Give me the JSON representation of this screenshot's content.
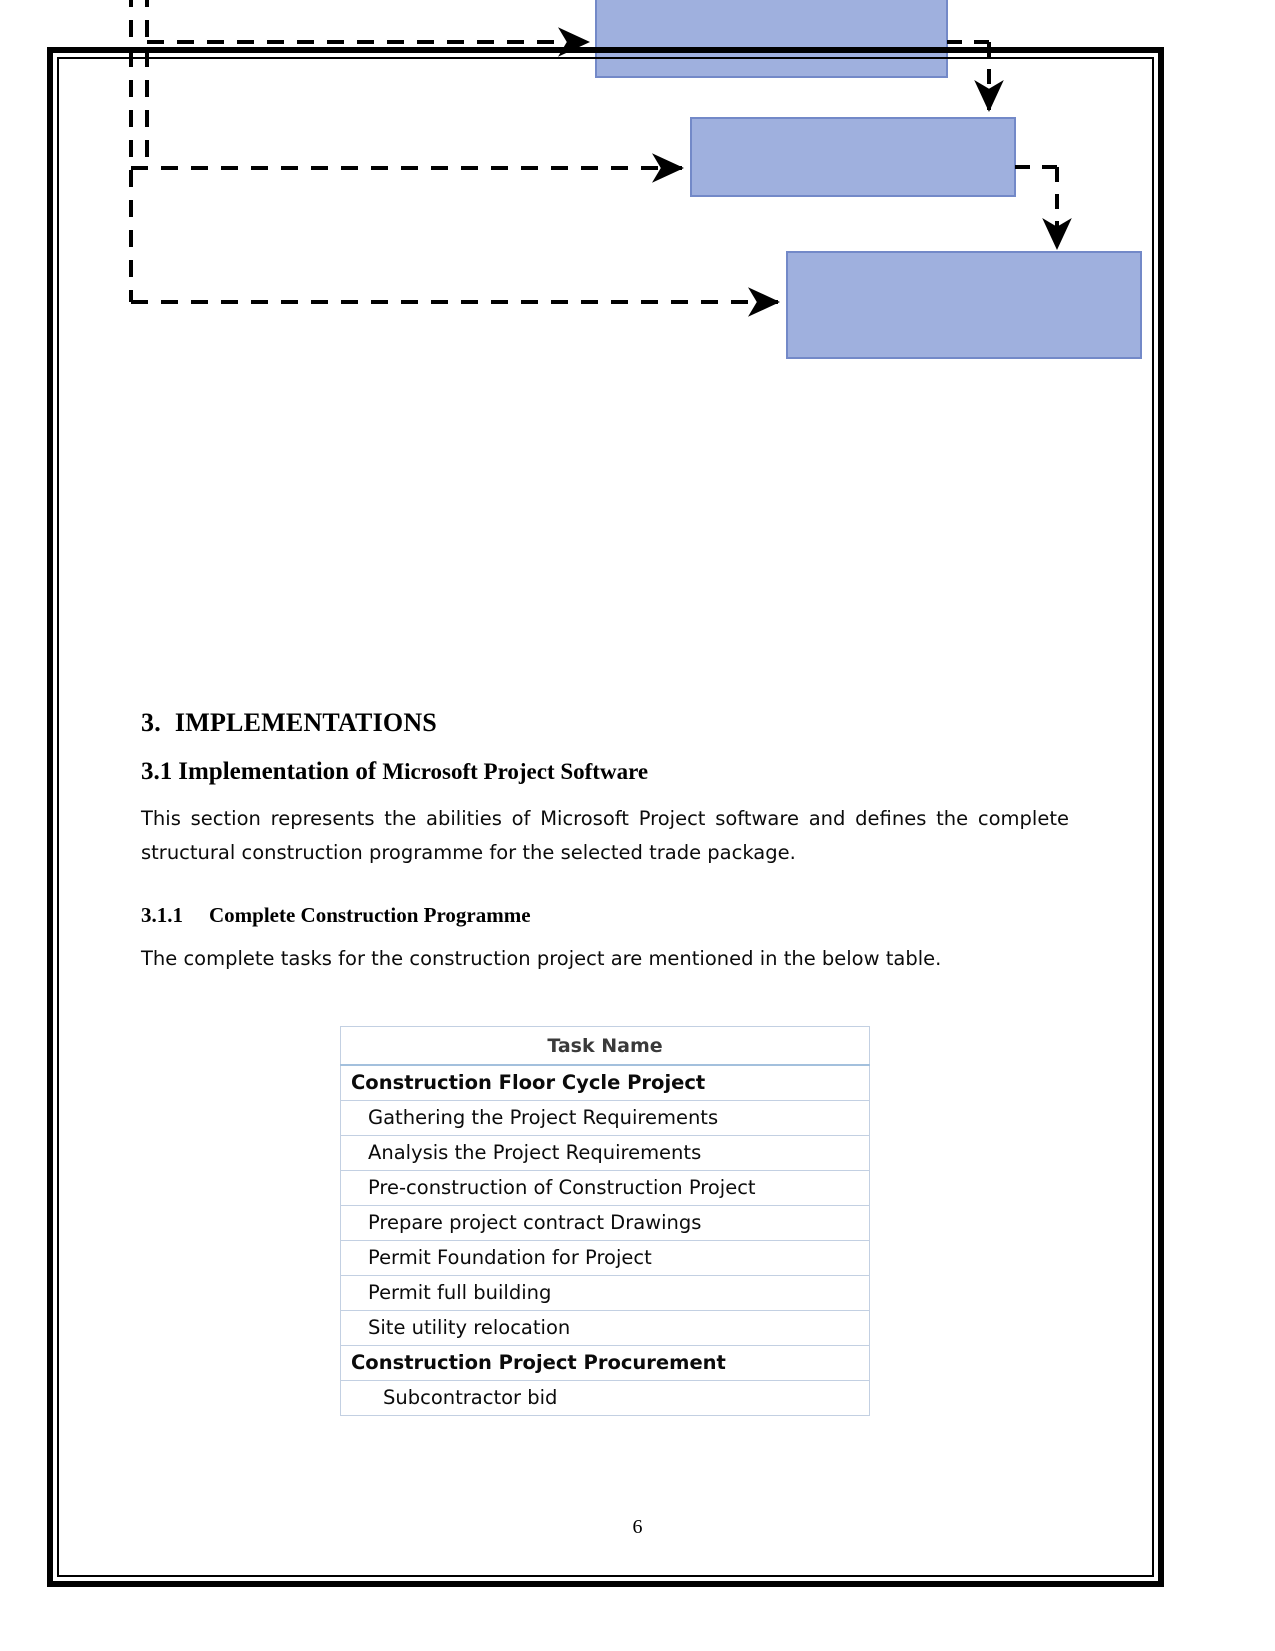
{
  "document": {
    "page_number": "6"
  },
  "diagram": {
    "type": "flowchart",
    "description": "Partially visible flowchart with three light-blue rectangular nodes connected by dashed arrows",
    "node_fill": "#9FB0DE",
    "node_border": "#7389C8",
    "connector_color": "#000000",
    "nodes": [
      {
        "id": "node-1",
        "label": ""
      },
      {
        "id": "node-2",
        "label": ""
      },
      {
        "id": "node-3",
        "label": ""
      }
    ]
  },
  "headings": {
    "section_number": "3.",
    "section_title": "IMPLEMENTATIONS",
    "sub_number": "3.1",
    "sub_title_lead": "Implementation of",
    "sub_title_tail": "Microsoft Project Software",
    "subsub_number": "3.1.1",
    "subsub_title": "Complete Construction Programme"
  },
  "paragraphs": {
    "intro": "This section represents the abilities of Microsoft Project software and defines the complete structural construction programme for the selected trade package.",
    "table_lead": "The complete tasks for the construction project are mentioned in the below table."
  },
  "task_table": {
    "column_header": "Task Name",
    "rows": [
      {
        "name": "Construction Floor Cycle Project",
        "level": 0
      },
      {
        "name": "Gathering the Project Requirements",
        "level": 1
      },
      {
        "name": "Analysis the Project Requirements",
        "level": 1
      },
      {
        "name": "Pre-construction of Construction Project",
        "level": 1
      },
      {
        "name": "Prepare project contract Drawings",
        "level": 1
      },
      {
        "name": "Permit Foundation for Project",
        "level": 1
      },
      {
        "name": "Permit full building",
        "level": 1
      },
      {
        "name": "Site utility relocation",
        "level": 1
      },
      {
        "name": "Construction Project Procurement",
        "level": 0
      },
      {
        "name": "Subcontractor bid",
        "level": 2
      }
    ]
  },
  "colors": {
    "node_fill": "#9FB0DE",
    "node_border": "#7389C8",
    "table_grid": "#C3D0E2",
    "table_header_rule": "#A3C0DD",
    "text": "#0B0B0B"
  }
}
